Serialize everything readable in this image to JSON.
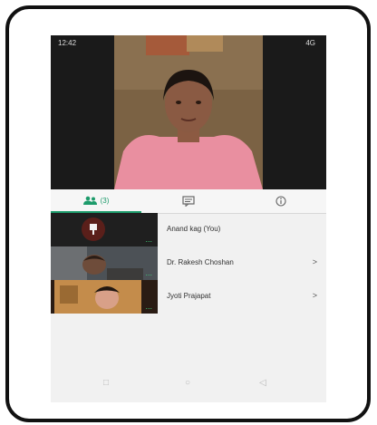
{
  "status_bar": {
    "time": "12:42",
    "indicators": "4G"
  },
  "tabs": {
    "people_count": "(3)",
    "people_icon": "people-icon",
    "chat_icon": "chat-icon",
    "info_icon": "info-icon"
  },
  "participants": [
    {
      "name": "Anand kag (You)",
      "chevron": ""
    },
    {
      "name": "Dr. Rakesh Choshan",
      "chevron": ">"
    },
    {
      "name": "Jyoti Prajapat",
      "chevron": ">"
    }
  ],
  "thumbs": {
    "more": "..."
  },
  "nav": {
    "square": "□",
    "circle": "○",
    "back": "◁"
  },
  "colors": {
    "accent": "#1d9b6b",
    "video_bg": "#1a1a1a",
    "shirt": "#e98fa0"
  }
}
